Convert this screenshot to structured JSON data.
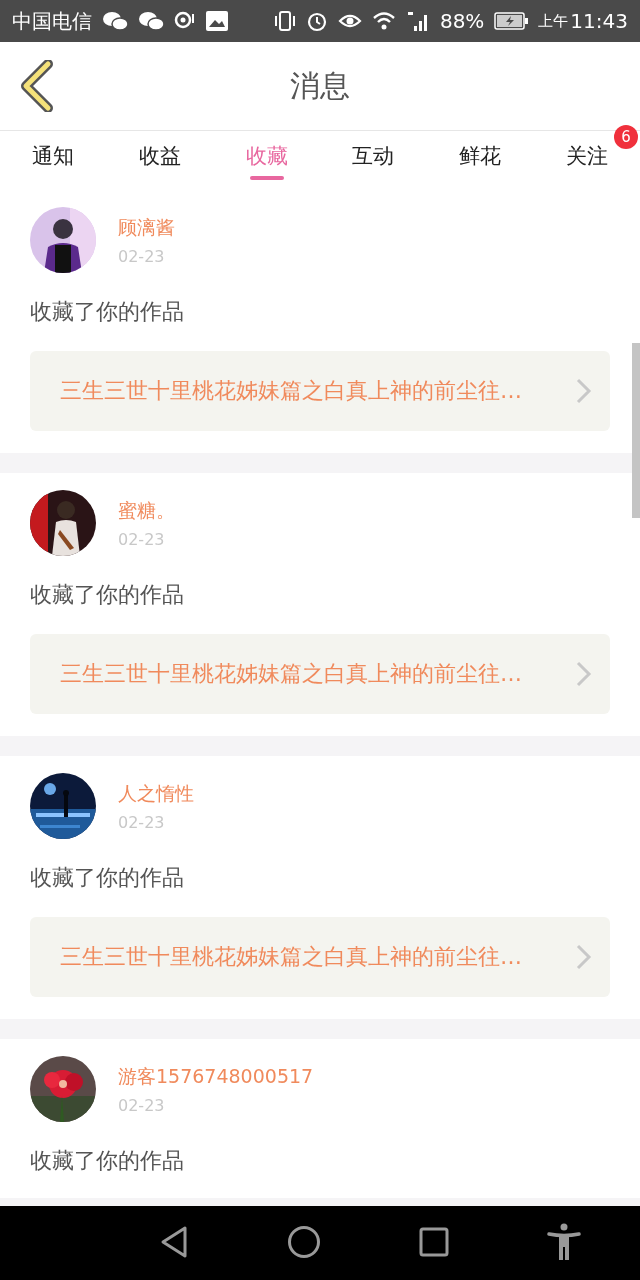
{
  "status_bar": {
    "carrier": "中国电信",
    "battery": "88%",
    "time_prefix": "上午",
    "time": "11:43"
  },
  "header": {
    "title": "消息"
  },
  "tabs": [
    {
      "label": "通知",
      "selected": false
    },
    {
      "label": "收益",
      "selected": false
    },
    {
      "label": "收藏",
      "selected": true
    },
    {
      "label": "互动",
      "selected": false
    },
    {
      "label": "鲜花",
      "selected": false
    },
    {
      "label": "关注",
      "selected": false,
      "badge": "6"
    }
  ],
  "notifications": [
    {
      "name": "顾漓酱",
      "date": "02-23",
      "action": "收藏了你的作品",
      "work": "三生三世十里桃花姊妹篇之白真上神的前尘往…"
    },
    {
      "name": "蜜糖。",
      "date": "02-23",
      "action": "收藏了你的作品",
      "work": "三生三世十里桃花姊妹篇之白真上神的前尘往…"
    },
    {
      "name": "人之惰性",
      "date": "02-23",
      "action": "收藏了你的作品",
      "work": "三生三世十里桃花姊妹篇之白真上神的前尘往…"
    },
    {
      "name": "游客1576748000517",
      "date": "02-23",
      "action": "收藏了你的作品"
    }
  ]
}
